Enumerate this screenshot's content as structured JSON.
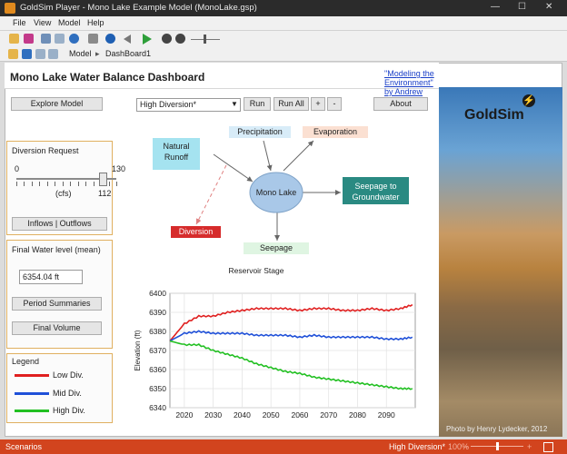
{
  "window": {
    "title": "GoldSim Player - Mono Lake Example Model (MonoLake.gsp)",
    "minimize": "—",
    "maximize": "☐",
    "close": "✕"
  },
  "menu": [
    "File",
    "View",
    "Model",
    "Help"
  ],
  "nav": {
    "path_1": "Model",
    "separator": "▸",
    "path_2": "DashBoard1"
  },
  "dashboard": {
    "title": "Mono Lake Water Balance Dashboard",
    "link": "\"Modeling the Environment\" by Andrew Ford",
    "explore_button": "Explore Model",
    "scenario_value": "High Diversion*",
    "run_button": "Run",
    "run_all_button": "Run All",
    "plus_button": "+",
    "minus_button": "-",
    "about_button": "About"
  },
  "diversion_panel": {
    "title": "Diversion Request",
    "slider_min": "0",
    "slider_max": "130",
    "slider_value": "112",
    "slider_fraction": 0.862,
    "unit": "(cfs)",
    "button": "Inflows | Outflows"
  },
  "water_panel": {
    "title": "Final Water level (mean)",
    "value": "6354.04 ft",
    "summaries_button": "Period Summaries",
    "volume_button": "Final Volume"
  },
  "legend": {
    "title": "Legend",
    "items": [
      {
        "label": "Low Div.",
        "color": "#e02020"
      },
      {
        "label": "Mid Div.",
        "color": "#1f50d8"
      },
      {
        "label": "High Div.",
        "color": "#22c022"
      }
    ]
  },
  "diagram": {
    "natural_runoff": "Natural Runoff",
    "precipitation": "Precipitation",
    "evaporation": "Evaporation",
    "mono_lake": "Mono Lake",
    "seepage_gw": "Seepage to Groundwater",
    "diversion": "Diversion",
    "seepage": "Seepage"
  },
  "chart_data": {
    "type": "line",
    "title": "Reservoir Stage",
    "xlabel": "",
    "ylabel": "Elevation (ft)",
    "xlim": [
      2015,
      2100
    ],
    "ylim": [
      6340,
      6400
    ],
    "xticks": [
      "2020",
      "2030",
      "2040",
      "2050",
      "2060",
      "2070",
      "2080",
      "2090"
    ],
    "yticks": [
      "6340",
      "6350",
      "6360",
      "6370",
      "6380",
      "6390",
      "6400"
    ],
    "x": [
      2015,
      2020,
      2025,
      2030,
      2035,
      2040,
      2045,
      2050,
      2055,
      2060,
      2065,
      2070,
      2075,
      2080,
      2085,
      2090,
      2095,
      2099
    ],
    "series": [
      {
        "name": "Low Div.",
        "color": "#e02020",
        "values": [
          6375,
          6384,
          6388,
          6388,
          6390,
          6391,
          6392,
          6392,
          6392,
          6391,
          6392,
          6392,
          6391,
          6391,
          6392,
          6391,
          6392,
          6394
        ]
      },
      {
        "name": "Mid Div.",
        "color": "#1f50d8",
        "values": [
          6375,
          6379,
          6380,
          6379,
          6379,
          6379,
          6378,
          6378,
          6378,
          6377,
          6378,
          6377,
          6377,
          6377,
          6377,
          6376,
          6376,
          6377
        ]
      },
      {
        "name": "High Div.",
        "color": "#22c022",
        "values": [
          6375,
          6373,
          6373,
          6370,
          6368,
          6366,
          6363,
          6361,
          6359,
          6358,
          6356,
          6355,
          6354,
          6353,
          6352,
          6351,
          6350,
          6350
        ]
      }
    ]
  },
  "photo_credit": "Photo by Henry Lydecker, 2012",
  "logo": "GoldSim",
  "status": {
    "left": "Scenarios",
    "scenario": "High Diversion*",
    "zoom": "100%"
  }
}
